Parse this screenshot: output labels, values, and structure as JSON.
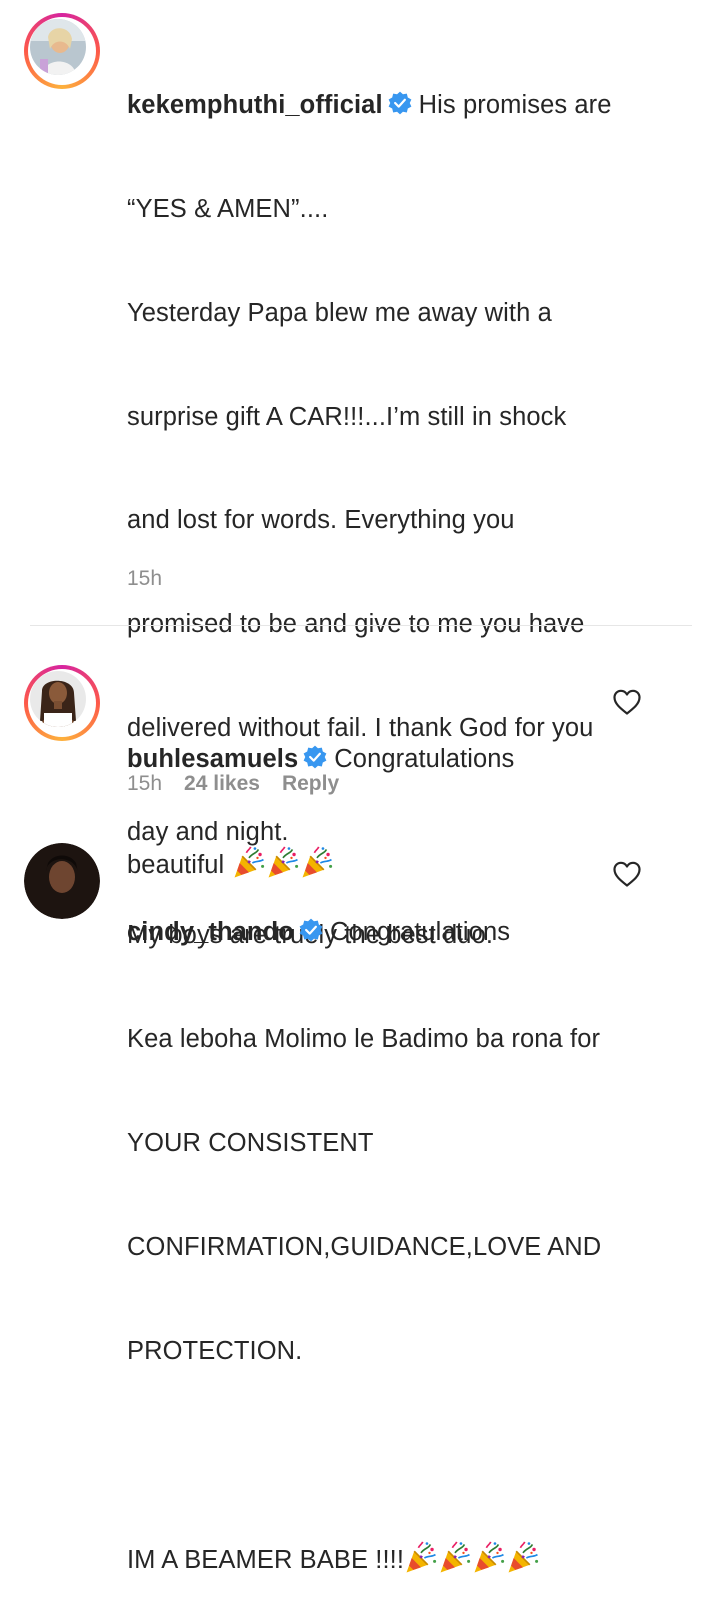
{
  "comments": [
    {
      "username": "kekemphuthi_official",
      "verified": true,
      "lines": [
        "His promises are",
        "“YES & AMEN”....",
        "Yesterday Papa blew me away with a",
        "surprise gift A CAR!!!...I’m still in shock",
        "and lost for words. Everything you",
        "promised to be and give to me you have",
        "delivered without fail. I thank God for you",
        "day and night.",
        "My boys are truely the best duo.",
        "Kea leboha Molimo le Badimo ba rona for",
        "YOUR CONSISTENT",
        "CONFIRMATION,GUIDANCE,LOVE AND",
        "PROTECTION.",
        "",
        "IM A BEAMER BABE !!!!"
      ],
      "emoji": "party-popper",
      "time": "15h"
    },
    {
      "username": "buhlesamuels",
      "verified": true,
      "text_first": "Congratulations",
      "text_second": "beautiful",
      "emoji": "party-popper",
      "time": "15h",
      "likes": "24 likes",
      "reply": "Reply"
    },
    {
      "username": "cindy_thando",
      "verified": true,
      "text_first": "Congratulations"
    }
  ],
  "colors": {
    "text": "#262626",
    "meta": "#8e8e8e",
    "verified_blue": "#3897f0",
    "story_ring": "#d6249f"
  }
}
